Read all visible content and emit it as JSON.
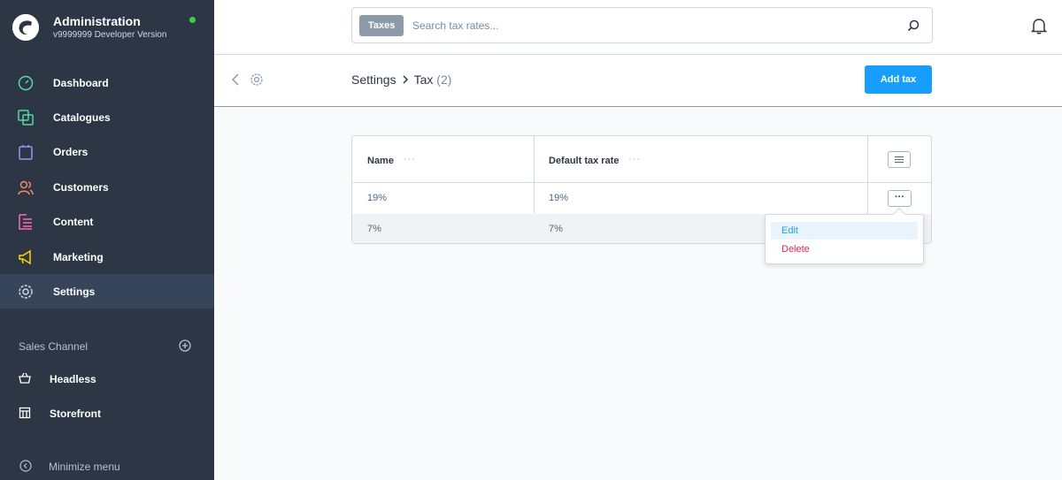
{
  "brand": {
    "title": "Administration",
    "version": "v9999999 Developer Version",
    "status_color": "#37d046"
  },
  "nav": [
    {
      "label": "Dashboard",
      "icon": "dashboard-icon",
      "color": "#57d9a3"
    },
    {
      "label": "Catalogues",
      "icon": "catalogues-icon",
      "color": "#57d9a3"
    },
    {
      "label": "Orders",
      "icon": "orders-icon",
      "color": "#a092f0"
    },
    {
      "label": "Customers",
      "icon": "customers-icon",
      "color": "#f88962"
    },
    {
      "label": "Content",
      "icon": "content-icon",
      "color": "#ff68b4"
    },
    {
      "label": "Marketing",
      "icon": "marketing-icon",
      "color": "#ffd700"
    },
    {
      "label": "Settings",
      "icon": "settings-icon",
      "color": "#d1d9e0",
      "active": true
    }
  ],
  "sales_channel": {
    "label": "Sales Channel",
    "items": [
      {
        "label": "Headless",
        "icon": "basket-icon"
      },
      {
        "label": "Storefront",
        "icon": "storefront-icon"
      }
    ]
  },
  "minimize_label": "Minimize menu",
  "search": {
    "tag": "Taxes",
    "placeholder": "Search tax rates..."
  },
  "smartbar": {
    "crumb_root": "Settings",
    "crumb_current": "Tax",
    "count": "(2)",
    "add_label": "Add tax"
  },
  "grid": {
    "columns": [
      "Name",
      "Default tax rate"
    ],
    "rows": [
      {
        "name": "19%",
        "rate": "19%"
      },
      {
        "name": "7%",
        "rate": "7%"
      }
    ]
  },
  "context_menu": {
    "edit": "Edit",
    "delete": "Delete"
  },
  "colors": {
    "primary": "#189eff",
    "sidebar": "#2c3645",
    "danger": "#de294c"
  }
}
